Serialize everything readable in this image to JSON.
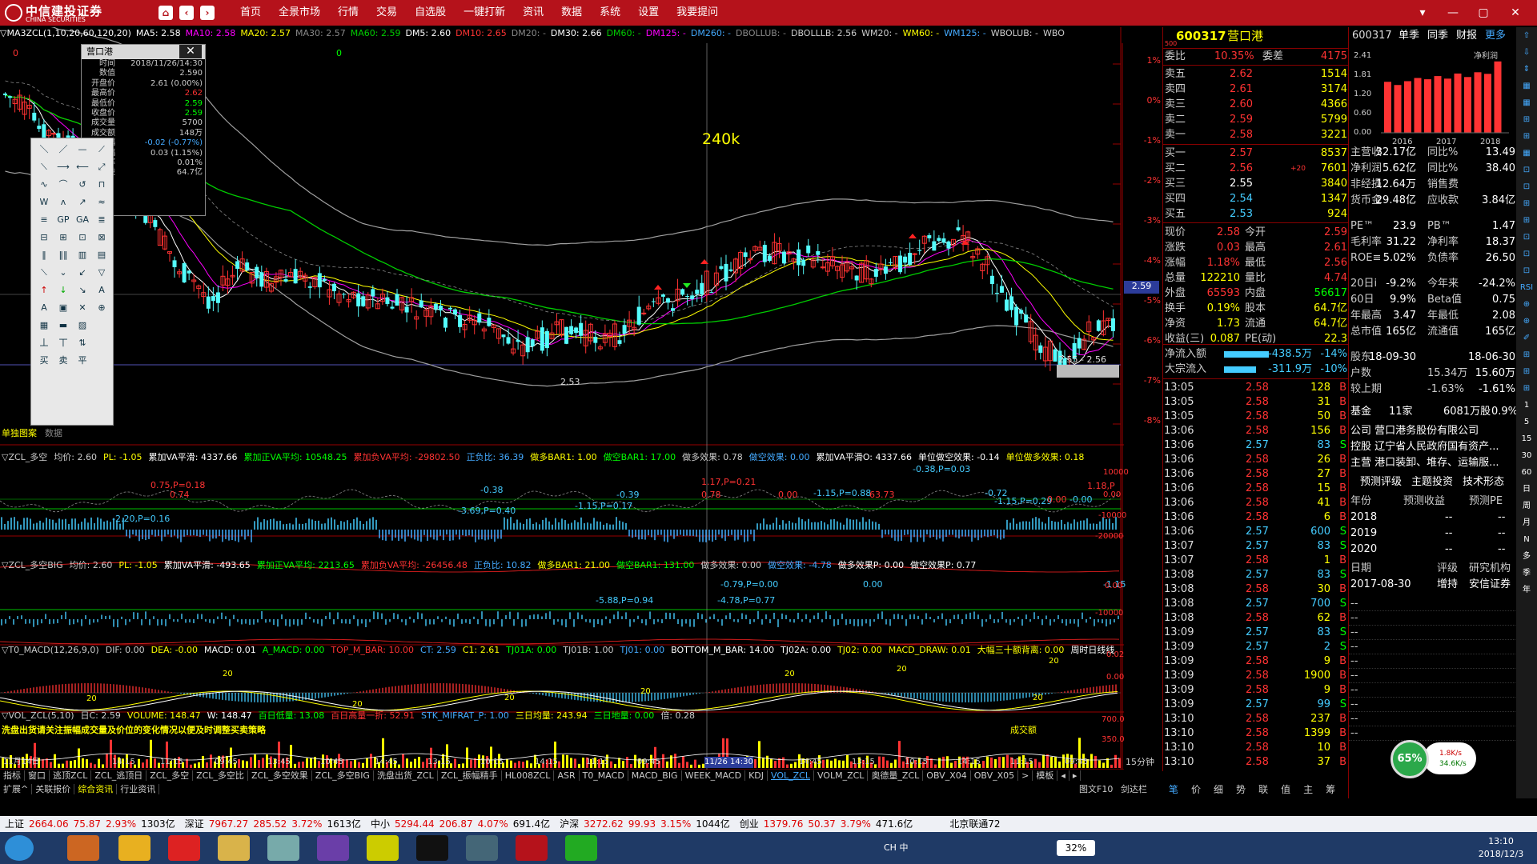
{
  "app": {
    "logo_cn": "中信建投证券",
    "logo_en": "CHINA SECURITIES",
    "menu": [
      "首页",
      "全景市场",
      "行情",
      "交易",
      "自选股",
      "一键打新",
      "资讯",
      "数据",
      "系统",
      "设置",
      "我要提问"
    ],
    "window_controls": [
      "▾",
      "—",
      "▢",
      "✕"
    ]
  },
  "header": {
    "chart_name": "营口港(15分钟)",
    "ma_line": [
      "▽MA3ZCL(1,10,20,60,120,20)",
      "MA5: 2.58",
      "MA10: 2.58",
      "MA20: 2.57",
      "MA30: 2.57",
      "MA60: 2.59",
      "DM5: 2.60",
      "DM10: 2.65",
      "DM20: -",
      "DM30: 2.66",
      "DM60: -",
      "DM125: -",
      "DM260: -",
      "DBOLLUB: -",
      "DBOLLLB: 2.56",
      "WM20: -",
      "WM60: -",
      "WM125: -",
      "WBOLUB: -",
      "WBO"
    ],
    "crosshair_label": "240k",
    "cur_price_tag": "2.59",
    "low_label": "2.53",
    "box_label": "2.55 - 2.56",
    "zero_left": "0",
    "zero_mid": "0",
    "pct_ticks": [
      "1%",
      "0%",
      "-1%",
      "-2%",
      "-3%",
      "-4%",
      "-5%",
      "-6%",
      "-7%",
      "-8%"
    ],
    "left_label": "单独图案",
    "left_label2": "数据"
  },
  "popup": {
    "title": "营口港",
    "rows": [
      [
        "时间",
        "2018/11/26/14:30"
      ],
      [
        "数值",
        "2.590"
      ],
      [
        "开盘价",
        "2.61 (0.00%)"
      ],
      [
        "最高价",
        "2.62"
      ],
      [
        "最低价",
        "2.59"
      ],
      [
        "收盘价",
        "2.59"
      ],
      [
        "成交量",
        "5700"
      ],
      [
        "成交额",
        "148万"
      ],
      [
        "涨幅",
        "-0.02 (-0.77%)"
      ],
      [
        "振幅",
        "0.03 (1.15%)"
      ],
      [
        "换手率",
        "0.01%"
      ],
      [
        "流通股",
        "64.7亿"
      ]
    ]
  },
  "toolbox": {
    "items": [
      "＼",
      "／",
      "—",
      "⟋",
      "⟍",
      "⟶",
      "⟵",
      "⤢",
      "∿",
      "⌒",
      "↺",
      "⊓",
      "W",
      "ʌ",
      "↗",
      "≈",
      "≡",
      "GP",
      "GA",
      "≣",
      "⊟",
      "⊞",
      "⊡",
      "⊠",
      "‖",
      "‖‖",
      "▥",
      "▤",
      "⟍",
      "⌄",
      "↙",
      "▽",
      "↑",
      "↓",
      "↘",
      "A",
      "A",
      "▣",
      "✕",
      "⊕",
      "▦",
      "▬",
      "▨",
      "",
      "丄",
      "丅",
      "⇅",
      "",
      "买",
      "卖",
      "平",
      ""
    ]
  },
  "panels": {
    "p1": [
      "▽ZCL_多空",
      "均价: 2.60",
      "PL: -1.05",
      "累加VA平滑: 4337.66",
      "累加正VA平均: 10548.25",
      "累加负VA平均: -29802.50",
      "正负比: 36.39",
      "做多BAR1: 1.00",
      "做空BAR1: 17.00",
      "做多效果: 0.78",
      "做空效果: 0.00",
      "累加VA平滑O: 4337.66",
      "单位做空效果: -0.14",
      "单位做多效果: 0.18"
    ],
    "p1_labels": [
      "0.75,P=0.18",
      "0.74",
      "-0.38",
      "-0.39",
      "1.17,P=0.21",
      "0.78",
      "0.00",
      "-1.15,P=0.88",
      "-0.38,P=0.03",
      "-0.72",
      "1.18,P",
      "-0.00",
      "-2.20,P=0.16",
      "-3.69,P=0.40",
      "-1.15,P=0.17",
      "-1.15,P=0.29",
      "0.00",
      "63.73"
    ],
    "p1_ticks": [
      "10000",
      "0.00",
      "-10000",
      "-20000"
    ],
    "p2": [
      "▽ZCL_多空BIG",
      "均价: 2.60",
      "PL: -1.05",
      "累加VA平滑: -493.65",
      "累加正VA平均: 2213.65",
      "累加负VA平均: -26456.48",
      "正负比: 10.82",
      "做多BAR1: 21.00",
      "做空BAR1: 131.00",
      "做多效果: 0.00",
      "做空效果: -4.78",
      "做多效果P: 0.00",
      "做空效果P: 0.77"
    ],
    "p2_labels": [
      "-5.88,P=0.94",
      "-4.78,P=0.77",
      "-0.79,P=0.00",
      "0.00",
      "-1.15"
    ],
    "p2_ticks": [
      "0.00",
      "-10000"
    ],
    "p3": [
      "▽T0_MACD(12,26,9,0)",
      "DIF: 0.00",
      "DEA: -0.00",
      "MACD: 0.01",
      "A_MACD: 0.00",
      "TOP_M_BAR: 10.00",
      "CT: 2.59",
      "C1: 2.61",
      "TJ01A: 0.00",
      "TJ01B: 1.00",
      "TJ01: 0.00",
      "BOTTOM_M_BAR: 14.00",
      "TJ02A: 0.00",
      "TJ02: 0.00",
      "MACD_DRAW: 0.01",
      "大幅三十额背离: 0.00",
      "周时日线线"
    ],
    "p3_labels": [
      "20",
      "20",
      "20",
      "20",
      "20",
      "20",
      "20",
      "20",
      "20"
    ],
    "p3_ticks": [
      "0.02",
      "0.00"
    ],
    "p4": [
      "▽VOL_ZCL(5,10)",
      "日C: 2.59",
      "VOLUME: 148.47",
      "W: 148.47",
      "百日低量: 13.08",
      "百日高量一折: 52.91",
      "STK_MIFRAT_P: 1.00",
      "三日均量: 243.94",
      "三日地量: 0.00",
      "倍: 0.28"
    ],
    "p4_ticks": [
      "700.0",
      "350.0"
    ],
    "p4_note": "洗盘出货请关注振幅成交量及价位的变化情况以便及时调整买卖策略",
    "p4_note2": "成交额"
  },
  "xaxis": [
    "11月14日",
    "14:15",
    "11:15",
    "09:45",
    "13:45",
    "10:45",
    "14:45",
    "13:15",
    "10:15",
    "14:15",
    "11:15",
    "09:45",
    "11/26 14:30",
    "14:45",
    "13:15",
    "10:15",
    "14:15",
    "11:15",
    "09:45"
  ],
  "xaxis_unit": "15分钟",
  "tabs1": [
    "指标",
    "窗口",
    "逃顶ZCL",
    "ZCL_逃顶日",
    "ZCL_多空",
    "ZCL_多空比",
    "ZCL_多空效果",
    "ZCL_多空BIG",
    "洗盘出货_ZCL",
    "ZCL_振幅精手",
    "HL008ZCL",
    "ASR",
    "T0_MACD",
    "MACD_BIG",
    "WEEK_MACD",
    "KDJ",
    "VOL_ZCL",
    "VOLM_ZCL",
    "奥德量_ZCL",
    "OBV_X04",
    "OBV_X05",
    ">",
    "模板",
    "◂",
    "▸"
  ],
  "tabs2": [
    "扩展^",
    "关联报价",
    "综合资讯",
    "行业资讯"
  ],
  "tabs2_right": [
    "图文F10",
    "剑达栏"
  ],
  "quote": {
    "code": "600317",
    "name": "营口港",
    "ratio_label": "委比",
    "ratio_val": "10.35%",
    "diff_label": "委差",
    "diff_val": "4175",
    "sells": [
      [
        "卖五",
        "2.62",
        "1514"
      ],
      [
        "卖四",
        "2.61",
        "3174"
      ],
      [
        "卖三",
        "2.60",
        "4366"
      ],
      [
        "卖二",
        "2.59",
        "5799"
      ],
      [
        "卖一",
        "2.58",
        "3221"
      ]
    ],
    "buys": [
      [
        "买一",
        "2.57",
        "8537",
        ""
      ],
      [
        "买二",
        "2.56",
        "7601",
        "+20"
      ],
      [
        "买三",
        "2.55",
        "3840",
        ""
      ],
      [
        "买四",
        "2.54",
        "1347",
        ""
      ],
      [
        "买五",
        "2.53",
        "924",
        ""
      ]
    ],
    "stats": [
      [
        "现价",
        "2.58",
        "今开",
        "2.59"
      ],
      [
        "涨跌",
        "0.03",
        "最高",
        "2.61"
      ],
      [
        "涨幅",
        "1.18%",
        "最低",
        "2.56"
      ],
      [
        "总量",
        "122210",
        "量比",
        "4.74"
      ],
      [
        "外盘",
        "65593",
        "内盘",
        "56617"
      ],
      [
        "换手",
        "0.19%",
        "股本",
        "64.7亿"
      ],
      [
        "净资",
        "1.73",
        "流通",
        "64.7亿"
      ],
      [
        "收益(三)",
        "0.087",
        "PE(动)",
        "22.3"
      ]
    ],
    "flows": [
      [
        "净流入额",
        "-438.5万",
        "-14%"
      ],
      [
        "大宗流入",
        "-311.9万",
        "-10%"
      ]
    ]
  },
  "ticks": [
    [
      "13:05",
      "2.58",
      "128",
      "B"
    ],
    [
      "13:05",
      "2.58",
      "31",
      "B"
    ],
    [
      "13:05",
      "2.58",
      "50",
      "B"
    ],
    [
      "13:06",
      "2.58",
      "156",
      "B"
    ],
    [
      "13:06",
      "2.57",
      "83",
      "S"
    ],
    [
      "13:06",
      "2.58",
      "26",
      "B"
    ],
    [
      "13:06",
      "2.58",
      "27",
      "B"
    ],
    [
      "13:06",
      "2.58",
      "15",
      "B"
    ],
    [
      "13:06",
      "2.58",
      "41",
      "B"
    ],
    [
      "13:06",
      "2.58",
      "6",
      "B"
    ],
    [
      "13:06",
      "2.57",
      "600",
      "S"
    ],
    [
      "13:07",
      "2.57",
      "83",
      "S"
    ],
    [
      "13:07",
      "2.58",
      "1",
      "B"
    ],
    [
      "13:08",
      "2.57",
      "83",
      "S"
    ],
    [
      "13:08",
      "2.58",
      "30",
      "B"
    ],
    [
      "13:08",
      "2.57",
      "700",
      "S"
    ],
    [
      "13:08",
      "2.58",
      "62",
      "B"
    ],
    [
      "13:09",
      "2.57",
      "83",
      "S"
    ],
    [
      "13:09",
      "2.57",
      "2",
      "S"
    ],
    [
      "13:09",
      "2.58",
      "9",
      "B"
    ],
    [
      "13:09",
      "2.58",
      "1900",
      "B"
    ],
    [
      "13:09",
      "2.58",
      "9",
      "B"
    ],
    [
      "13:09",
      "2.57",
      "99",
      "S"
    ],
    [
      "13:10",
      "2.58",
      "237",
      "B"
    ],
    [
      "13:10",
      "2.58",
      "1399",
      "B"
    ],
    [
      "13:10",
      "2.58",
      "10",
      "B"
    ],
    [
      "13:10",
      "2.58",
      "37",
      "B"
    ]
  ],
  "rtabs": [
    "笔",
    "价",
    "细",
    "势",
    "联",
    "值",
    "主",
    "筹"
  ],
  "fund": {
    "code": "600317",
    "tabs": [
      "单季",
      "同季",
      "财报",
      "更多"
    ],
    "chart_title": "净利润",
    "bars": [
      1.6,
      1.5,
      1.62,
      1.72,
      1.68,
      1.78,
      1.7,
      1.86,
      1.75,
      1.9,
      1.85,
      2.24
    ],
    "yticks": [
      "2.41",
      "1.81",
      "1.20",
      "0.60",
      "0.00"
    ],
    "years": [
      "2016",
      "2017",
      "2018"
    ],
    "rows": [
      [
        "主营收",
        "32.17亿",
        "同比%",
        "13.49"
      ],
      [
        "净利润",
        "5.62亿",
        "同比%",
        "38.40"
      ],
      [
        "非经损",
        "12.64万",
        "销售费",
        ""
      ],
      [
        "货币金",
        "29.48亿",
        "应收款",
        "3.84亿"
      ]
    ],
    "rows2": [
      [
        "PE™",
        "23.9",
        "PB™",
        "1.47"
      ],
      [
        "毛利率",
        "31.22",
        "净利率",
        "18.37"
      ],
      [
        "ROE≡",
        "5.02%",
        "负债率",
        "26.50"
      ]
    ],
    "rows3": [
      [
        "20日i",
        "-9.2%",
        "今年来",
        "-24.2%"
      ],
      [
        "60日",
        "9.9%",
        "Beta值",
        "0.75"
      ],
      [
        "年最高",
        "3.47",
        "年最低",
        "2.08"
      ],
      [
        "总市值",
        "165亿",
        "流通值",
        "165亿"
      ]
    ],
    "rows4": [
      [
        "股东",
        "18-09-30",
        "",
        "18-06-30"
      ],
      [
        "户数",
        "",
        "15.34万",
        "15.60万"
      ],
      [
        "较上期",
        "",
        "-1.63%",
        "-1.61%"
      ]
    ],
    "fund_line": [
      "基金",
      "11家",
      "6081万股",
      "0.9%"
    ],
    "company": "公司 营口港务股份有限公司",
    "holder": "控股 辽宁省人民政府国有资产...",
    "business": "主营 港口装卸、堆存、运输服...",
    "btn": [
      "预测评级",
      "主题投资",
      "技术形态"
    ],
    "forecast_head": [
      "年份",
      "预测收益",
      "预测PE"
    ],
    "forecast": [
      [
        "2018",
        "--",
        "--"
      ],
      [
        "2019",
        "--",
        "--"
      ],
      [
        "2020",
        "--",
        "--"
      ]
    ],
    "rating_head": [
      "日期",
      "评级",
      "研究机构"
    ],
    "rating": [
      "2017-08-30",
      "增持",
      "安信证券"
    ]
  },
  "sidebar": [
    "⇧",
    "⇩",
    "⇕",
    "▦",
    "▦",
    "⊞",
    "⊞",
    "▦",
    "⊡",
    "⊡",
    "⊞",
    "⊞",
    "⊡",
    "⊡",
    "⊡",
    "RSI",
    "⊕",
    "⊕",
    "✐",
    "⊞",
    "⊞",
    "⊞",
    "1",
    "5",
    "15",
    "30",
    "60",
    "日",
    "周",
    "月",
    "N",
    "多",
    "季",
    "年"
  ],
  "gauge": {
    "pct": "65%",
    "up": "1.8K/s",
    "down": "34.6K/s"
  },
  "status": [
    [
      "上证",
      "2664.06",
      "75.87",
      "2.93%",
      "1303亿"
    ],
    [
      "深证",
      "7967.27",
      "285.52",
      "3.72%",
      "1613亿"
    ],
    [
      "中小",
      "5294.44",
      "206.87",
      "4.07%",
      "691.4亿"
    ],
    [
      "沪深",
      "3272.62",
      "99.93",
      "3.15%",
      "1044亿"
    ],
    [
      "创业",
      "1379.76",
      "50.37",
      "3.79%",
      "471.6亿"
    ]
  ],
  "status_right": "北京联通72",
  "tray": {
    "cpu": "32%",
    "time": "13:10",
    "date": "2018/12/3",
    "ime": "CH 中"
  },
  "colors": {
    "brand": "#b5121b",
    "up": "#ff3232",
    "down": "#54fcfc",
    "ma5": "#ffffff",
    "ma10": "#ff00ff",
    "ma20": "#ffff00",
    "ma60": "#00cc00",
    "boll": "#a0a0a0"
  }
}
